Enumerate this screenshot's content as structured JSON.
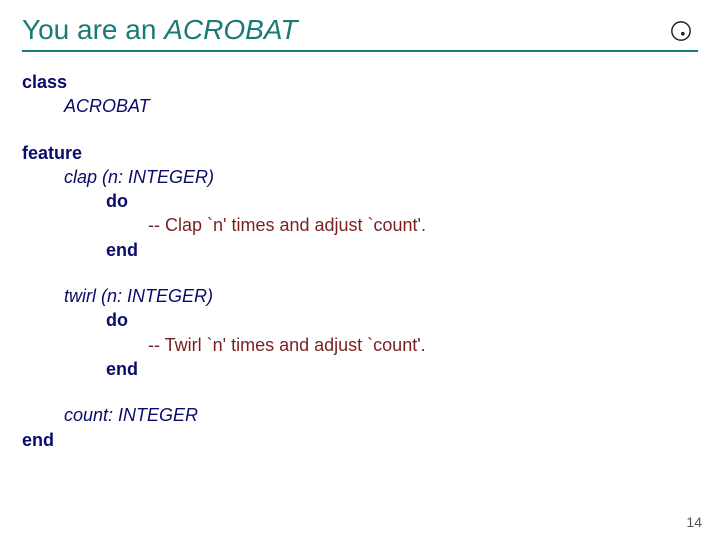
{
  "title": {
    "prefix": "You are an ",
    "name": "ACROBAT"
  },
  "code": {
    "kw_class": "class",
    "class_name": "ACROBAT",
    "kw_feature": "feature",
    "clap_sig": "clap (n: INTEGER)",
    "kw_do1": "do",
    "clap_comment": "-- Clap `n' times and adjust `count'.",
    "kw_end1": "end",
    "twirl_sig": "twirl (n: INTEGER)",
    "kw_do2": "do",
    "twirl_comment": "-- Twirl `n' times and adjust `count'.",
    "kw_end2": "end",
    "count_decl": "count: INTEGER",
    "kw_end_class": "end"
  },
  "page_number": "14"
}
